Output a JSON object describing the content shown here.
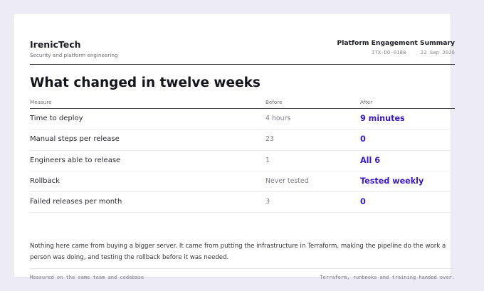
{
  "header": {
    "brand_name": "IrenicTech",
    "brand_tagline": "Security and platform engineering",
    "doc_title": "Platform Engagement Summary",
    "doc_id": "ITX-DO-0188",
    "doc_date": "22 Sep 2026"
  },
  "main": {
    "title": "What changed in twelve weeks",
    "table": {
      "columns": [
        "Measure",
        "Before",
        "After"
      ],
      "rows": [
        {
          "measure": "Time to deploy",
          "before": "4 hours",
          "after": "9 minutes"
        },
        {
          "measure": "Manual steps per release",
          "before": "23",
          "after": "0"
        },
        {
          "measure": "Engineers able to release",
          "before": "1",
          "after": "All 6"
        },
        {
          "measure": "Rollback",
          "before": "Never tested",
          "after": "Tested weekly"
        },
        {
          "measure": "Failed releases per month",
          "before": "3",
          "after": "0"
        }
      ]
    },
    "summary": "Nothing here came from buying a bigger server. It came from putting the infrastructure in Terraform, making the pipeline do the work a person was doing, and testing the rollback before it was needed."
  },
  "footer": {
    "left": "Measured on the same team and codebase",
    "right": "Terraform, runbooks and training handed over."
  },
  "colors": {
    "accent": "#3a17c4",
    "background": "#ecebf6",
    "card": "#ffffff"
  }
}
